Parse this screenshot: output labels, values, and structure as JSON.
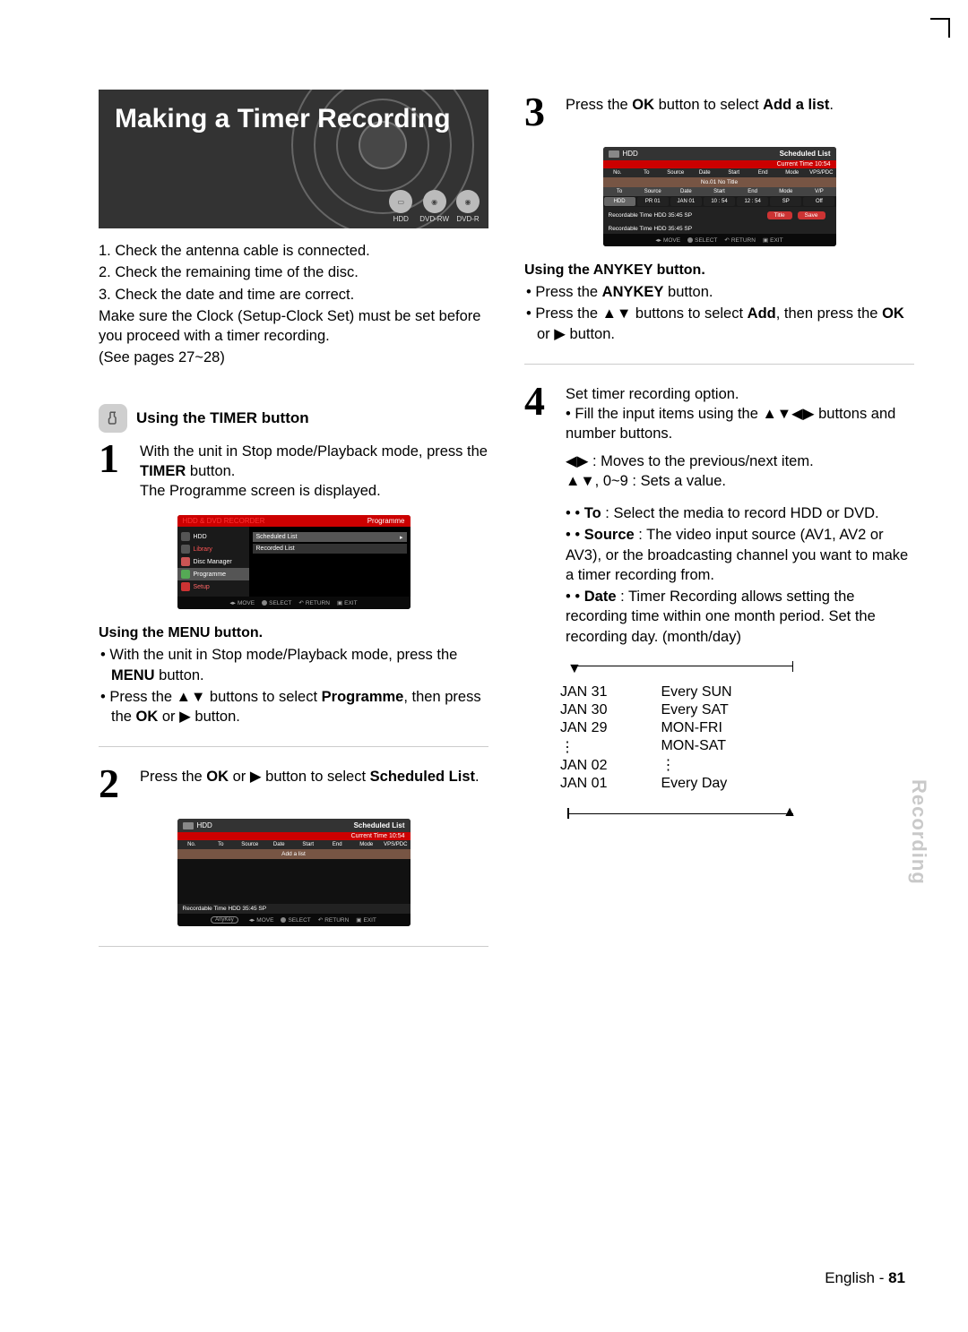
{
  "title": "Making a Timer Recording",
  "media_icons": [
    "HDD",
    "DVD-RW",
    "DVD-R"
  ],
  "intro": {
    "l1": "1. Check the antenna cable is connected.",
    "l2": "2. Check the remaining time of the disc.",
    "l3": "3. Check the date and time are correct.",
    "l4": "Make sure the Clock (Setup-Clock Set) must be set before you proceed with a timer recording.",
    "l5": "(See pages 27~28)"
  },
  "section_timer": "Using the TIMER button",
  "step1": {
    "num": "1",
    "p1a": "With the unit in Stop mode/Playback mode, press the ",
    "p1b": "TIMER",
    "p1c": " button.",
    "p2": "The Programme screen is displayed."
  },
  "screen1": {
    "top_left": "HDD & DVD RECORDER",
    "top_right": "Programme",
    "side": {
      "hdd": "HDD",
      "library": "Library",
      "disc": "Disc Manager",
      "programme": "Programme",
      "setup": "Setup"
    },
    "main": {
      "scheduled": "Scheduled List",
      "recorded": "Recorded List"
    },
    "bottom": {
      "move": "MOVE",
      "select": "SELECT",
      "return": "RETURN",
      "exit": "EXIT"
    }
  },
  "menu_section": {
    "head": "Using the MENU button.",
    "b1a": "With the unit in Stop mode/Playback mode, press the ",
    "b1b": "MENU",
    "b1c": " button.",
    "b2a": "Press the ▲▼ buttons to select ",
    "b2b": "Programme",
    "b2c": ", then press the ",
    "b2d": "OK",
    "b2e": " or ▶ button."
  },
  "step2": {
    "num": "2",
    "t1": "Press the ",
    "t2": "OK",
    "t3": " or ▶ button to select ",
    "t4": "Scheduled List",
    "t5": "."
  },
  "screen2": {
    "hdd": "HDD",
    "title": "Scheduled List",
    "time": "Current Time 10:54",
    "cols": [
      "No.",
      "To",
      "Source",
      "Date",
      "Start",
      "End",
      "Mode",
      "VPS/PDC"
    ],
    "add": "Add a list",
    "rt": "Recordable Time  HDD  35:45 SP",
    "anykey": "AnyKey",
    "bottom": {
      "move": "MOVE",
      "select": "SELECT",
      "return": "RETURN",
      "exit": "EXIT"
    }
  },
  "step3": {
    "num": "3",
    "t1": "Press the ",
    "t2": "OK",
    "t3": " button to select ",
    "t4": "Add a list",
    "t5": "."
  },
  "screen3": {
    "hdd": "HDD",
    "title": "Scheduled List",
    "time": "Current Time 10:54",
    "cols": [
      "No.",
      "To",
      "Source",
      "Date",
      "Start",
      "End",
      "Mode",
      "VPS/PDC"
    ],
    "notitle": "No.01 No Title",
    "cols2": [
      "To",
      "Source",
      "Date",
      "Start",
      "End",
      "Mode",
      "V/P"
    ],
    "row": [
      "HDD",
      "PR 01",
      "JAN 01",
      "10 : 54",
      "12 : 54",
      "SP",
      "Off"
    ],
    "rt1": "Recordable Time  HDD  35:45 SP",
    "btn_title": "Title",
    "btn_save": "Save",
    "rt2": "Recordable Time  HDD  35:45 SP",
    "bottom": {
      "move": "MOVE",
      "select": "SELECT",
      "return": "RETURN",
      "exit": "EXIT"
    }
  },
  "anykey_section": {
    "head": "Using the ANYKEY button.",
    "b1a": "Press the ",
    "b1b": "ANYKEY",
    "b1c": " button.",
    "b2a": "Press the ▲▼ buttons to select ",
    "b2b": "Add",
    "b2c": ", then press the ",
    "b2d": "OK",
    "b2e": " or ▶ button."
  },
  "step4": {
    "num": "4",
    "l1": "Set timer recording option.",
    "l2": "Fill the input items using the ▲▼◀▶ buttons and number buttons.",
    "l3": "◀▶ : Moves to the previous/next item.",
    "l4": "▲▼, 0~9 : Sets a value.",
    "to_a": "To",
    "to_b": " : Select the media to record HDD or DVD.",
    "src_a": "Source",
    "src_b": " : The video input source (AV1, AV2 or AV3), or the broadcasting channel you want to make a timer recording from.",
    "date_a": "Date",
    "date_b": " : Timer Recording allows setting the recording time within one month period. Set the recording day. (month/day)"
  },
  "date_diagram": {
    "left": [
      "JAN 31",
      "JAN 30",
      "JAN 29",
      "⋮",
      "JAN 02",
      "JAN 01"
    ],
    "right": [
      "Every SUN",
      "Every SAT",
      "MON-FRI",
      "MON-SAT",
      "⋮",
      "Every Day"
    ]
  },
  "side_tab": "Recording",
  "footer": {
    "lang": "English",
    "sep": " - ",
    "page": "81"
  }
}
